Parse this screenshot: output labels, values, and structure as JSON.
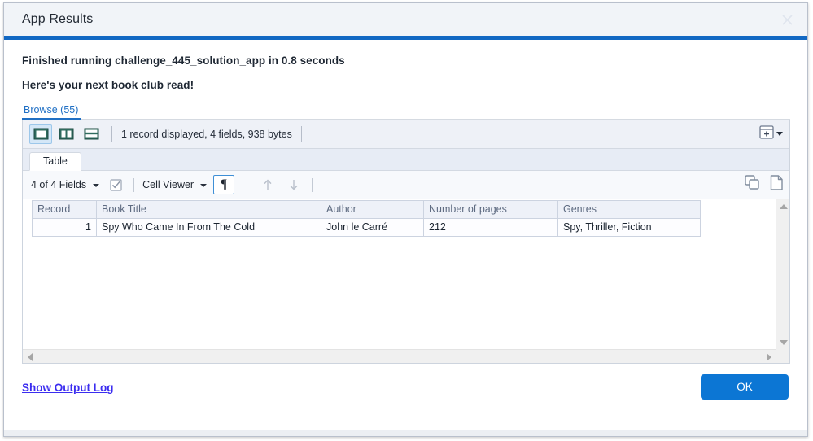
{
  "window": {
    "title": "App Results",
    "close_icon": "close-icon"
  },
  "messages": {
    "line1": "Finished running challenge_445_solution_app in 0.8 seconds",
    "line2": "Here's your next book club read!"
  },
  "browse": {
    "tab_label": "Browse (55)"
  },
  "fm_toolbar": {
    "view_form_icon": "form-view-icon",
    "view_list_icon": "list-view-icon",
    "view_table_icon": "table-view-icon",
    "status_text": "1 record displayed, 4 fields, 938 bytes",
    "new_record_icon": "new-record-icon",
    "new_record_caret_icon": "chevron-down-icon"
  },
  "table_tab": {
    "label": "Table"
  },
  "fields_toolbar": {
    "fields_label": "4 of 4 Fields",
    "fields_caret_icon": "chevron-down-icon",
    "checkbox_icon": "checkbox-checked-icon",
    "cell_viewer_label": "Cell Viewer",
    "cell_viewer_caret_icon": "chevron-down-icon",
    "pilcrow_label": "¶",
    "arrow_up_icon": "arrow-up-icon",
    "arrow_down_icon": "arrow-down-icon",
    "copy_icon": "copy-records-icon",
    "copy_field_icon": "copy-field-icon"
  },
  "grid": {
    "columns": [
      "Record",
      "Book Title",
      "Author",
      "Number of pages",
      "Genres"
    ],
    "rows": [
      {
        "record": "1",
        "title": "Spy Who Came In From The Cold",
        "author": "John le Carré",
        "pages": "212",
        "genres": "Spy, Thriller, Fiction"
      }
    ],
    "vscroll_up_icon": "scroll-up-icon",
    "vscroll_down_icon": "scroll-down-icon",
    "hscroll_left_icon": "scroll-left-icon",
    "hscroll_right_icon": "scroll-right-icon"
  },
  "footer": {
    "output_log_label": "Show Output Log",
    "ok_label": "OK"
  },
  "colors": {
    "accent_bar": "#1268c3",
    "primary_button": "#0c76d4",
    "link": "#3b2df0",
    "browse_tab": "#1f6fc4"
  }
}
